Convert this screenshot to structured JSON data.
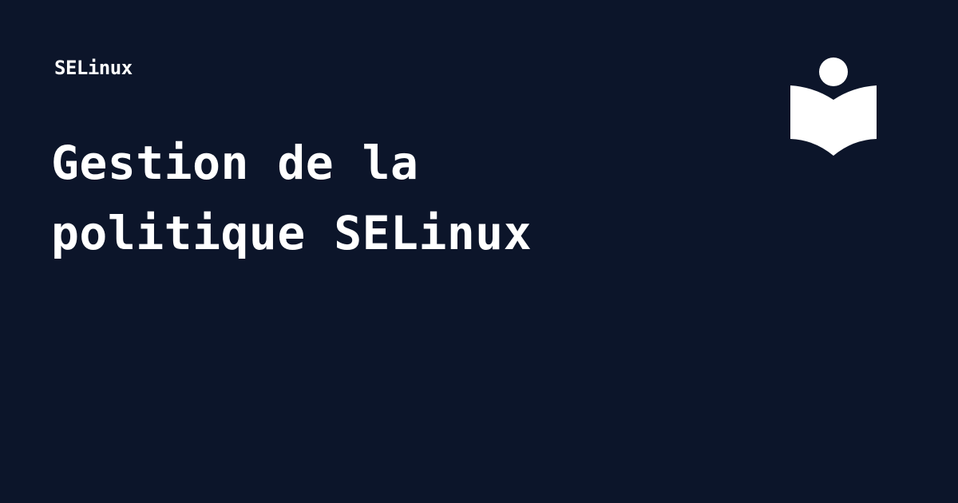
{
  "card": {
    "category": "SELinux",
    "title_lines": [
      "Gestion de la",
      "politique SELinux"
    ],
    "logo_icon": "reader-book-icon",
    "colors": {
      "background": "#0c152a",
      "foreground": "#ffffff"
    }
  }
}
